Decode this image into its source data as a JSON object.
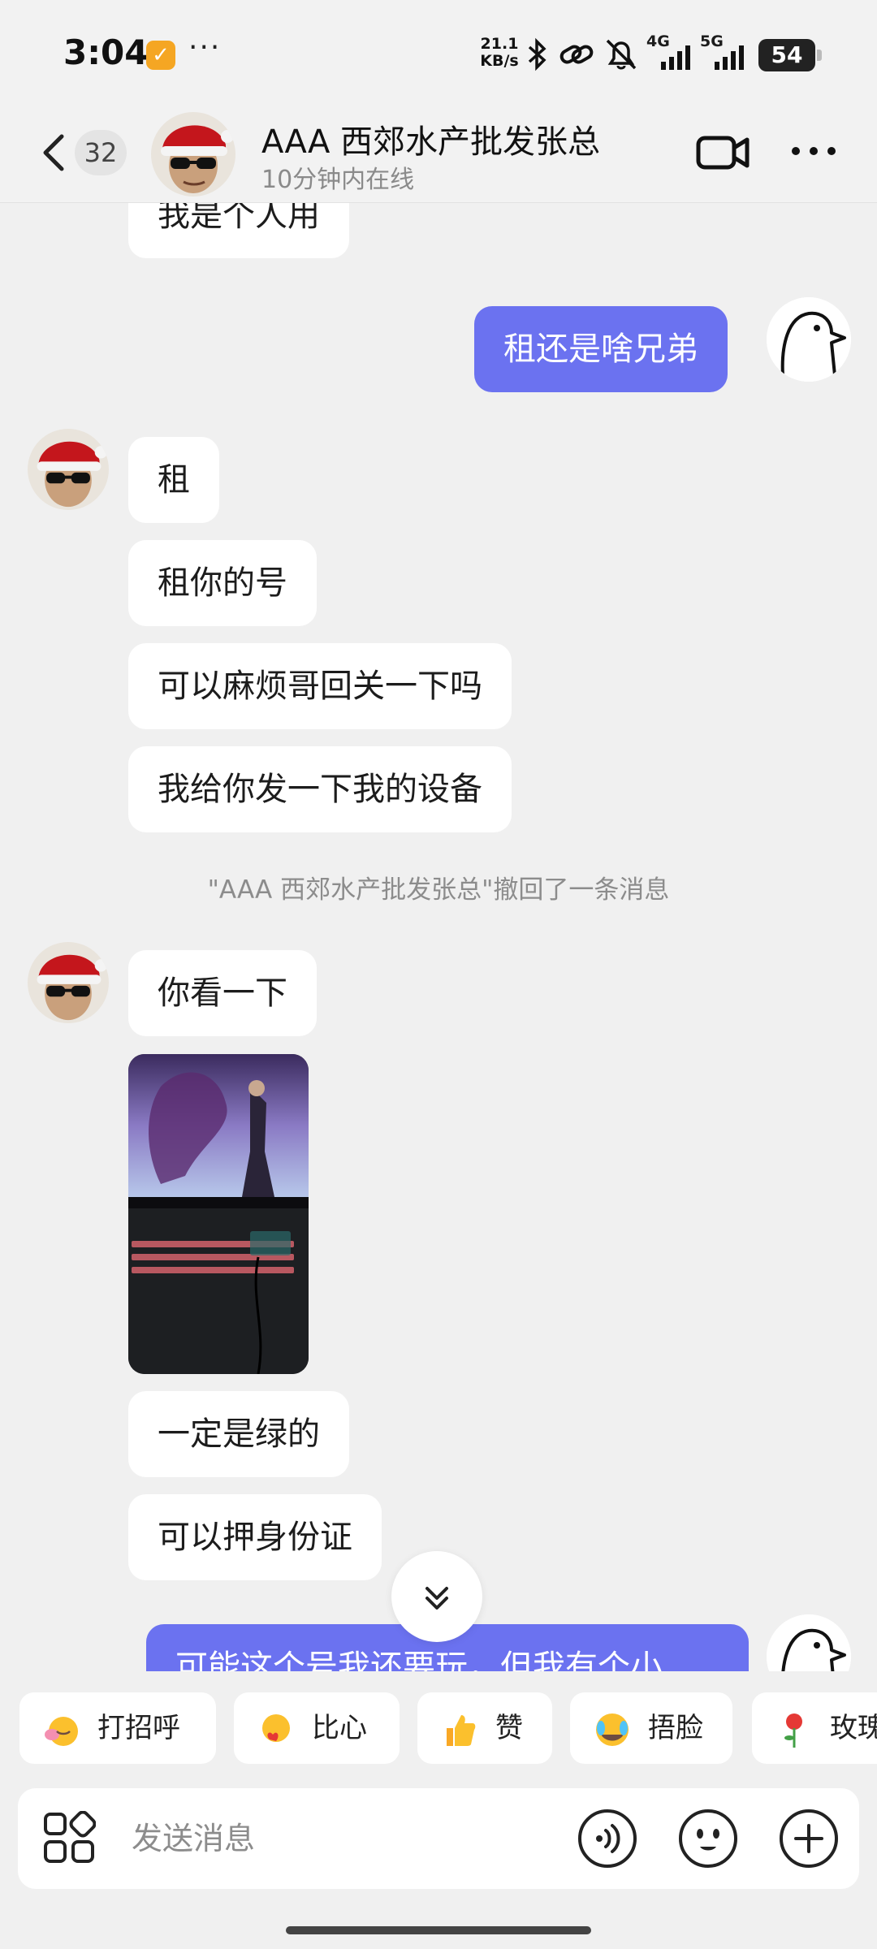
{
  "status_bar": {
    "time": "3:04",
    "net_speed_value": "21.1",
    "net_speed_unit": "KB/s",
    "network_1": "4G",
    "network_2": "5G",
    "battery": "54"
  },
  "header": {
    "unread_count": "32",
    "contact_name": "AAA 西郊水产批发张总",
    "online_status": "10分钟内在线"
  },
  "messages": [
    {
      "side": "them",
      "text": "我是个人用"
    },
    {
      "side": "me",
      "text": "租还是啥兄弟"
    },
    {
      "side": "them",
      "text": "租"
    },
    {
      "side": "them",
      "text": "租你的号"
    },
    {
      "side": "them",
      "text": "可以麻烦哥回关一下吗"
    },
    {
      "side": "them",
      "text": "我给你发一下我的设备"
    },
    {
      "side": "system",
      "text": "\"AAA 西郊水产批发张总\"撤回了一条消息"
    },
    {
      "side": "them",
      "text": "你看一下"
    },
    {
      "side": "them",
      "type": "image"
    },
    {
      "side": "them",
      "text": "一定是绿的"
    },
    {
      "side": "them",
      "text": "可以押身份证"
    },
    {
      "side": "me",
      "text": "可能这个号我还要玩，但我有个小"
    }
  ],
  "quick_replies": [
    {
      "label": "打招呼",
      "icon": "wave-emoji-icon"
    },
    {
      "label": "比心",
      "icon": "heart-hands-emoji-icon"
    },
    {
      "label": "赞",
      "icon": "thumbs-up-emoji-icon"
    },
    {
      "label": "捂脸",
      "icon": "facepalm-emoji-icon"
    },
    {
      "label": "玫瑰",
      "icon": "rose-emoji-icon"
    }
  ],
  "input": {
    "placeholder": "发送消息"
  },
  "colors": {
    "my_bubble": "#6b72f0",
    "their_bubble": "#ffffff",
    "background": "#f0f0f0"
  }
}
